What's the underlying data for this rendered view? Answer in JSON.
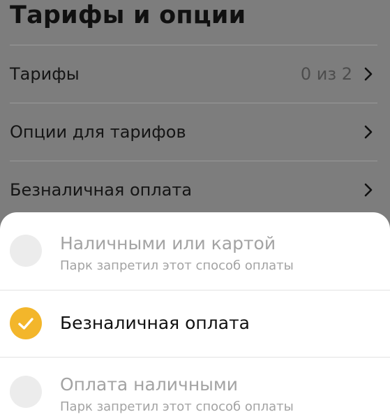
{
  "header": {
    "title": "Тарифы и опции"
  },
  "settings": {
    "items": [
      {
        "label": "Тарифы",
        "value": "0 из 2"
      },
      {
        "label": "Опции для тарифов"
      },
      {
        "label": "Безналичная оплата"
      }
    ]
  },
  "payment_sheet": {
    "options": [
      {
        "title": "Наличными или картой",
        "subtitle": "Парк запретил этот способ оплаты",
        "selected": false,
        "disabled": true
      },
      {
        "title": "Безналичная оплата",
        "selected": true,
        "disabled": false
      },
      {
        "title": "Оплата наличными",
        "subtitle": "Парк запретил этот способ оплаты",
        "selected": false,
        "disabled": true
      }
    ]
  },
  "colors": {
    "overlay_background": "#7d7d7d",
    "sheet_background": "#ffffff",
    "accent": "#f3b62b",
    "disabled_text": "#a3a3a3"
  },
  "icons": {
    "chevron": "chevron-right-icon",
    "check": "check-icon"
  }
}
